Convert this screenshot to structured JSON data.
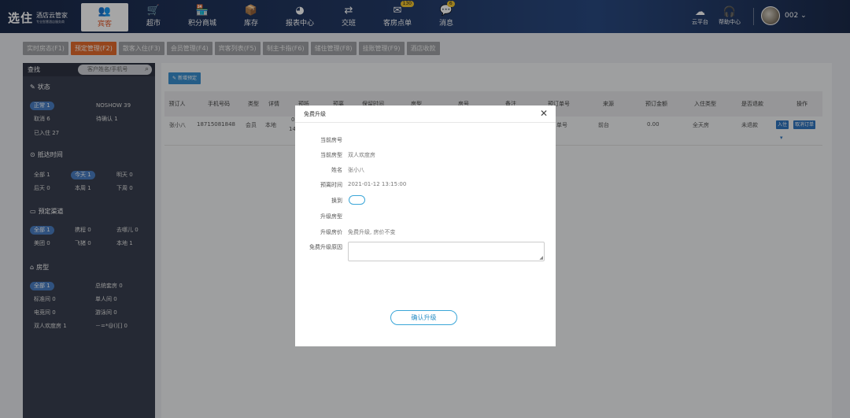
{
  "logo": {
    "big": "选住",
    "name": "酒店云管家",
    "tagline": "专业智慧酒店服务商"
  },
  "nav": [
    {
      "label": "宾客",
      "icon": "guests-icon",
      "active": true
    },
    {
      "label": "超市",
      "icon": "cart-icon"
    },
    {
      "label": "积分商城",
      "icon": "store-icon"
    },
    {
      "label": "库存",
      "icon": "box-icon"
    },
    {
      "label": "报表中心",
      "icon": "pie-chart-icon"
    },
    {
      "label": "交班",
      "icon": "handover-icon"
    },
    {
      "label": "客房点单",
      "icon": "order-icon",
      "badge": "130"
    },
    {
      "label": "消息",
      "icon": "message-icon",
      "badge": "6"
    }
  ],
  "top_right": {
    "cloud": "云平台",
    "help": "帮助中心",
    "user": "002",
    "caret": "⌄"
  },
  "tabs": [
    "实时房态(F1)",
    "预定管理(F2)",
    "散客入住(F3)",
    "会员管理(F4)",
    "宾客列表(F5)",
    "制主卡指(F6)",
    "储住管理(F8)",
    "挂账管理(F9)",
    "酒店收款"
  ],
  "left": {
    "title": "查找",
    "search_placeholder": "客户姓名/手机号",
    "sections": {
      "status": "状态",
      "arrival": "抵达时间",
      "channel": "预定渠道",
      "roomtype": "房型"
    },
    "status": {
      "all": "正常 1",
      "noshow": "NOSHOW 39",
      "cancel": "取消 6",
      "pending": "待确认 1",
      "checked_in": "已入住 27"
    },
    "arrival": {
      "all": "全部 1",
      "today": "今天 1",
      "tomorrow": "明天 0",
      "after": "后天 0",
      "week": "本周 1",
      "next_week": "下周 0"
    },
    "channel": {
      "all": "全部 1",
      "ctrip": "携程 0",
      "qunar": "去哪儿 0",
      "meituan": "美团 0",
      "fliggy": "飞猪 0",
      "local": "本地 1"
    },
    "roomtype": {
      "all": "全部 1",
      "presidential": "总统套房 0",
      "standard": "标准间 0",
      "single": "单人间 0",
      "esports": "电竞间 0",
      "pool": "游泳间 0",
      "double_deluxe": "双人欢度房 1",
      "odd": "－=*@()[] 0"
    }
  },
  "main": {
    "new_button": "新增预定",
    "headers": [
      "预订人",
      "手机号码",
      "类型",
      "详情",
      "预抵",
      "预离",
      "保留时间",
      "房型",
      "房号",
      "备注",
      "预订单号",
      "来源",
      "预订金额",
      "入住类型",
      "是否退款",
      "操作"
    ],
    "row": {
      "name": "张小八",
      "phone": "18715081848",
      "type": "会员",
      "detail": "本地",
      "arr_a": "0",
      "arr_b": "14",
      "order_no": "单号",
      "source": "前台",
      "amount": "0.00",
      "stay": "全天房",
      "refund": "未退款",
      "btn_checkin": "入住",
      "btn_cancel": "取消订单",
      "caret": "▾"
    }
  },
  "modal": {
    "title": "免费升级",
    "close": "✕",
    "fields": {
      "current_room_no": {
        "label": "当前房号",
        "value": ""
      },
      "current_room_type": {
        "label": "当前房型",
        "value": "双人欢度房"
      },
      "name": {
        "label": "姓名",
        "value": "张小八"
      },
      "checkout_time": {
        "label": "预离时间",
        "value": "2021-01-12 13:15:00"
      },
      "change_to": {
        "label": "换到"
      },
      "upgrade_type": {
        "label": "升级房型",
        "value": ""
      },
      "upgrade_price": {
        "label": "升级房价",
        "value": "免费升级, 房价不变"
      },
      "reason": {
        "label": "免费升级原因",
        "value": ""
      }
    },
    "confirm": "确认升级"
  },
  "colors": {
    "accent": "#e36a2d",
    "blue": "#3a8fd0",
    "topbar": "#1b2a4a",
    "modal_border": "#3aa6d8"
  }
}
